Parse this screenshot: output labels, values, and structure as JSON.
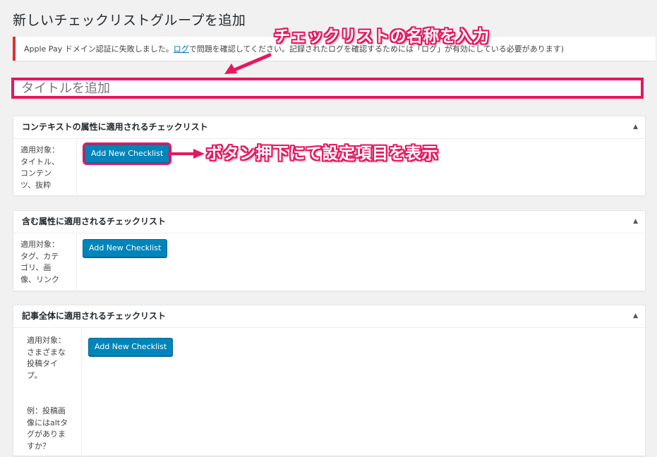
{
  "page": {
    "title": "新しいチェックリストグループを追加"
  },
  "notice": {
    "text_before": "Apple Pay ドメイン認証に失敗しました。",
    "link_text": "ログ",
    "text_after": "で問題を確認してください。記録されたログを確認するためには「ログ」が有効にしている必要があります)",
    "border_color": "#dc3232"
  },
  "title_field": {
    "placeholder": "タイトルを追加",
    "value": ""
  },
  "annotations": {
    "title_callout": "チェックリストの名称を入力",
    "button_callout": "ボタン押下にて設定項目を表示",
    "highlight_color": "#e8175d"
  },
  "boxes": [
    {
      "heading": "コンテキストの属性に適用されるチェックリスト",
      "target_text": "適用対象：\nタイトル、\nコンテン\nツ、抜粋",
      "button_label": "Add New Checklist"
    },
    {
      "heading": "含む属性に適用されるチェックリスト",
      "target_text": "適用対象：\nタグ、カテ\nゴリ、画\n像、リンク",
      "button_label": "Add New Checklist"
    },
    {
      "heading": "記事全体に適用されるチェックリスト",
      "target_text": "適用対象：\nさまざまな\n投稿タイ\nプ。",
      "example_text": "例：投稿画\n像にはaltタ\nグがありま\nすか？",
      "button_label": "Add New Checklist"
    }
  ],
  "icons": {
    "toggle": "triangle-up-icon"
  },
  "colors": {
    "button_bg": "#0085ba",
    "link": "#0073aa"
  }
}
